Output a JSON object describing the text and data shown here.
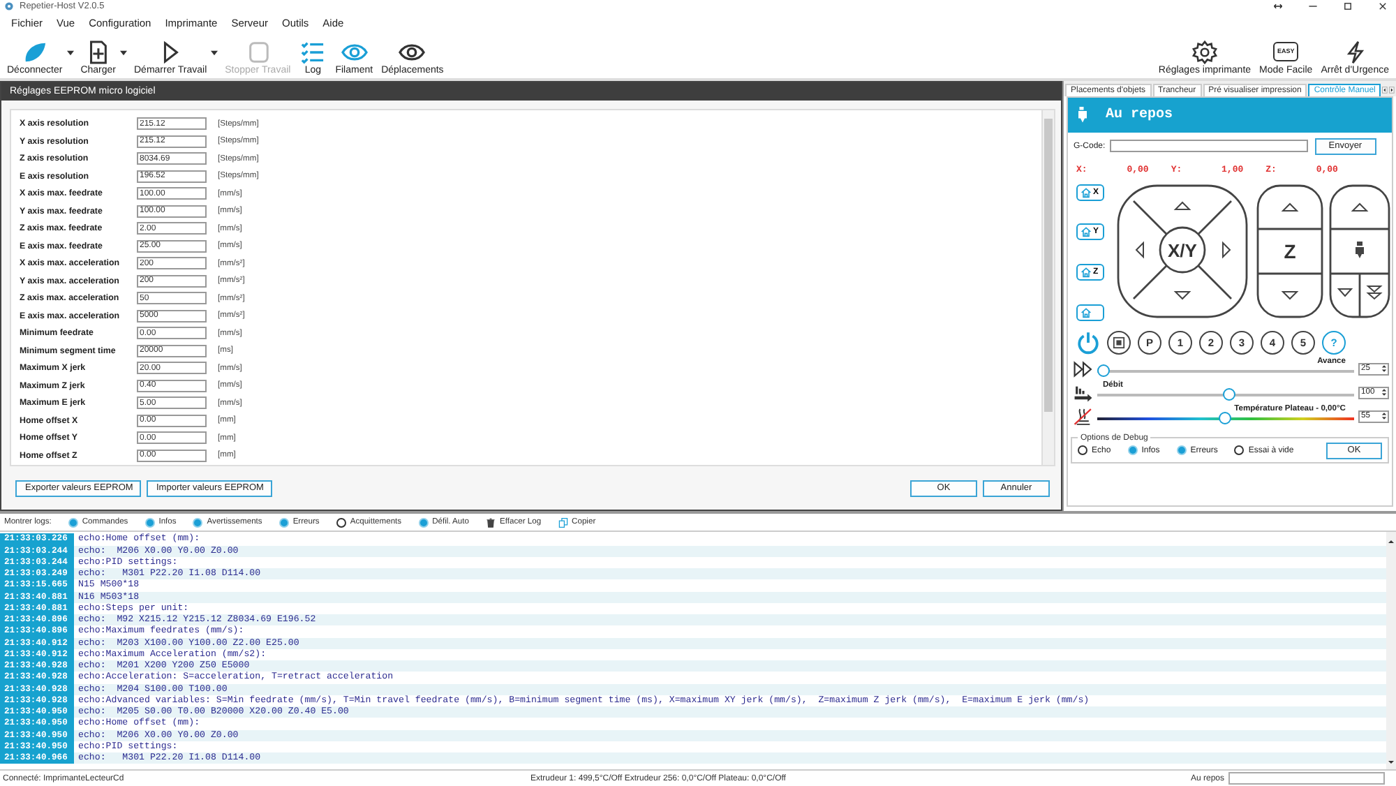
{
  "window": {
    "title": "Repetier-Host V2.0.5"
  },
  "menu": [
    "Fichier",
    "Vue",
    "Configuration",
    "Imprimante",
    "Serveur",
    "Outils",
    "Aide"
  ],
  "toolbar": [
    {
      "label": "Déconnecter",
      "kind": "connect",
      "disabled": false,
      "dropdown": true
    },
    {
      "label": "Charger",
      "kind": "load",
      "disabled": false,
      "dropdown": true
    },
    {
      "label": "Démarrer Travail",
      "kind": "start",
      "disabled": false,
      "dropdown": true
    },
    {
      "label": "Stopper Travail",
      "kind": "stop",
      "disabled": true
    },
    {
      "label": "Log",
      "kind": "log",
      "disabled": false
    },
    {
      "label": "Filament",
      "kind": "filament",
      "disabled": false
    },
    {
      "label": "Déplacements",
      "kind": "moves",
      "disabled": false
    }
  ],
  "toolbar_right": [
    {
      "label": "Réglages imprimante",
      "kind": "settings"
    },
    {
      "label": "Mode Facile",
      "kind": "easy",
      "icon_text": "EASY"
    },
    {
      "label": "Arrêt d'Urgence",
      "kind": "emergency"
    }
  ],
  "eeprom": {
    "title": "Réglages EEPROM micro logiciel",
    "rows": [
      {
        "label": "X axis resolution",
        "value": "215.12",
        "unit": "[Steps/mm]"
      },
      {
        "label": "Y axis resolution",
        "value": "215.12",
        "unit": "[Steps/mm]"
      },
      {
        "label": "Z axis resolution",
        "value": "8034.69",
        "unit": "[Steps/mm]"
      },
      {
        "label": "E axis resolution",
        "value": "196.52",
        "unit": "[Steps/mm]"
      },
      {
        "label": "X axis max. feedrate",
        "value": "100.00",
        "unit": "[mm/s]"
      },
      {
        "label": "Y axis max. feedrate",
        "value": "100.00",
        "unit": "[mm/s]"
      },
      {
        "label": "Z axis max. feedrate",
        "value": "2.00",
        "unit": "[mm/s]"
      },
      {
        "label": "E axis max. feedrate",
        "value": "25.00",
        "unit": "[mm/s]"
      },
      {
        "label": "X axis max. acceleration",
        "value": "200",
        "unit": "[mm/s²]"
      },
      {
        "label": "Y axis max. acceleration",
        "value": "200",
        "unit": "[mm/s²]"
      },
      {
        "label": "Z axis max. acceleration",
        "value": "50",
        "unit": "[mm/s²]"
      },
      {
        "label": "E axis max. acceleration",
        "value": "5000",
        "unit": "[mm/s²]"
      },
      {
        "label": "Minimum feedrate",
        "value": "0.00",
        "unit": "[mm/s]"
      },
      {
        "label": "Minimum segment time",
        "value": "20000",
        "unit": "[ms]"
      },
      {
        "label": "Maximum X jerk",
        "value": "20.00",
        "unit": "[mm/s]"
      },
      {
        "label": "Maximum Z jerk",
        "value": "0.40",
        "unit": "[mm/s]"
      },
      {
        "label": "Maximum E jerk",
        "value": "5.00",
        "unit": "[mm/s]"
      },
      {
        "label": "Home offset X",
        "value": "0.00",
        "unit": "[mm]"
      },
      {
        "label": "Home offset Y",
        "value": "0.00",
        "unit": "[mm]"
      },
      {
        "label": "Home offset Z",
        "value": "0.00",
        "unit": "[mm]"
      }
    ],
    "buttons_left": [
      "Exporter valeurs EEPROM",
      "Importer valeurs EEPROM"
    ],
    "buttons_right": [
      "OK",
      "Annuler"
    ]
  },
  "manual_control": {
    "tabs": [
      {
        "label": "Placements d'objets",
        "selected": false
      },
      {
        "label": "Trancheur",
        "selected": false
      },
      {
        "label": "Pré visualiser impression",
        "selected": false
      },
      {
        "label": "Contrôle Manuel",
        "selected": true
      }
    ],
    "status": "Au repos",
    "gcode_label": "G-Code:",
    "send_button": "Envoyer",
    "coords": [
      {
        "axis": "X:",
        "value": "0,00"
      },
      {
        "axis": "Y:",
        "value": "1,00"
      },
      {
        "axis": "Z:",
        "value": "0,00"
      }
    ],
    "home_buttons": [
      {
        "kind": "axis",
        "label": "X"
      },
      {
        "kind": "axis",
        "label": "Y"
      },
      {
        "kind": "axis",
        "label": "Z"
      },
      {
        "kind": "all"
      }
    ],
    "xy_label": "X/Y",
    "z_label": "Z",
    "circle_buttons": [
      {
        "kind": "power"
      },
      {
        "kind": "stop"
      },
      {
        "kind": "label",
        "label": "P"
      },
      {
        "kind": "label",
        "label": "1"
      },
      {
        "kind": "label",
        "label": "2"
      },
      {
        "kind": "label",
        "label": "3"
      },
      {
        "kind": "label",
        "label": "4"
      },
      {
        "kind": "label",
        "label": "5"
      },
      {
        "kind": "help",
        "label": "?"
      }
    ],
    "sliders": [
      {
        "kind": "speed",
        "label": "Avance",
        "level": 0.0,
        "reading": "25"
      },
      {
        "kind": "flow",
        "label": "Débit",
        "level": 0.52,
        "reading": "100"
      },
      {
        "kind": "temp",
        "label": "Température Plateau - 0,00°C",
        "level": 0.5,
        "reading": "55"
      }
    ],
    "debug": {
      "title": "Options de Debug",
      "options": [
        {
          "label": "Echo",
          "checked": false
        },
        {
          "label": "Infos",
          "checked": true
        },
        {
          "label": "Erreurs",
          "checked": true
        },
        {
          "label": "Essai à vide",
          "checked": false
        }
      ],
      "ok": "OK"
    }
  },
  "log": {
    "filter_label": "Montrer logs:",
    "filters": [
      {
        "label": "Commandes",
        "checked": true
      },
      {
        "label": "Infos",
        "checked": true
      },
      {
        "label": "Avertissements",
        "checked": true
      },
      {
        "label": "Erreurs",
        "checked": true
      },
      {
        "label": "Acquittements",
        "checked": false
      },
      {
        "label": "Défil. Auto",
        "checked": true
      }
    ],
    "actions": [
      {
        "label": "Effacer Log",
        "kind": "clear"
      },
      {
        "label": "Copier",
        "kind": "copy"
      }
    ],
    "rows": [
      {
        "time": "21:33:03.226",
        "text": "echo:Home offset (mm):"
      },
      {
        "time": "21:33:03.244",
        "text": "echo:  M206 X0.00 Y0.00 Z0.00"
      },
      {
        "time": "21:33:03.244",
        "text": "echo:PID settings:"
      },
      {
        "time": "21:33:03.249",
        "text": "echo:   M301 P22.20 I1.08 D114.00"
      },
      {
        "time": "21:33:15.665",
        "text": "N15 M500*18"
      },
      {
        "time": "21:33:40.881",
        "text": "N16 M503*18"
      },
      {
        "time": "21:33:40.881",
        "text": "echo:Steps per unit:"
      },
      {
        "time": "21:33:40.896",
        "text": "echo:  M92 X215.12 Y215.12 Z8034.69 E196.52"
      },
      {
        "time": "21:33:40.896",
        "text": "echo:Maximum feedrates (mm/s):"
      },
      {
        "time": "21:33:40.912",
        "text": "echo:  M203 X100.00 Y100.00 Z2.00 E25.00"
      },
      {
        "time": "21:33:40.912",
        "text": "echo:Maximum Acceleration (mm/s2):"
      },
      {
        "time": "21:33:40.928",
        "text": "echo:  M201 X200 Y200 Z50 E5000"
      },
      {
        "time": "21:33:40.928",
        "text": "echo:Acceleration: S=acceleration, T=retract acceleration"
      },
      {
        "time": "21:33:40.928",
        "text": "echo:  M204 S100.00 T100.00"
      },
      {
        "time": "21:33:40.928",
        "text": "echo:Advanced variables: S=Min feedrate (mm/s), T=Min travel feedrate (mm/s), B=minimum segment time (ms), X=maximum XY jerk (mm/s),  Z=maximum Z jerk (mm/s),  E=maximum E jerk (mm/s)"
      },
      {
        "time": "21:33:40.950",
        "text": "echo:  M205 S0.00 T0.00 B20000 X20.00 Z0.40 E5.00"
      },
      {
        "time": "21:33:40.950",
        "text": "echo:Home offset (mm):"
      },
      {
        "time": "21:33:40.950",
        "text": "echo:  M206 X0.00 Y0.00 Z0.00"
      },
      {
        "time": "21:33:40.950",
        "text": "echo:PID settings:"
      },
      {
        "time": "21:33:40.966",
        "text": "echo:   M301 P22.20 I1.08 D114.00"
      }
    ]
  },
  "status_bar": {
    "connection": "Connecté: ImprimanteLecteurCd",
    "temperatures": "Extrudeur 1: 499,5°C/Off Extrudeur 256: 0,0°C/Off Plateau: 0,0°C/Off",
    "state": "Au repos"
  }
}
